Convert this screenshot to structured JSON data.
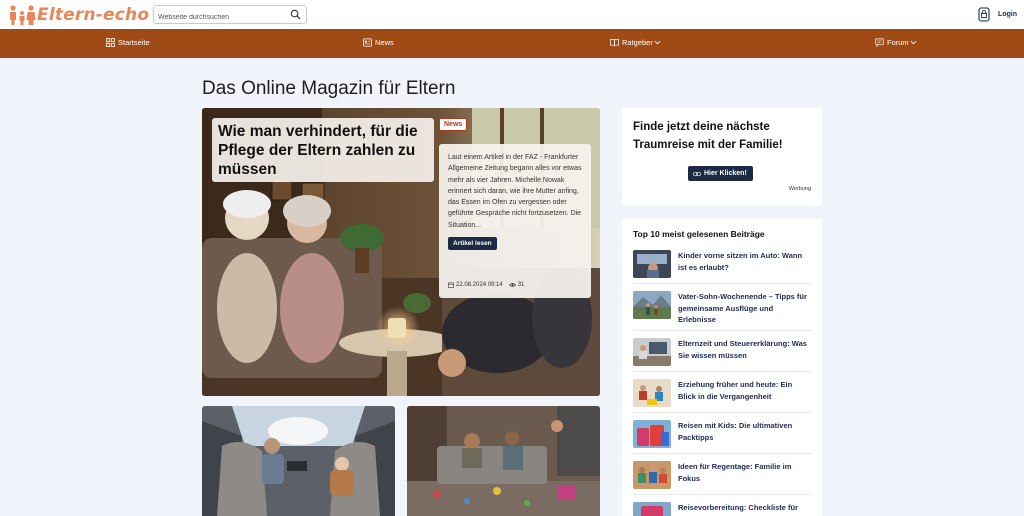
{
  "header": {
    "logo_text": "Eltern-echo",
    "search": {
      "placeholder": "Webseite durchsuchen"
    },
    "login_label": "Login"
  },
  "nav": {
    "items": [
      {
        "label": "Startseite",
        "icon": "grid-icon",
        "dropdown": false
      },
      {
        "label": "News",
        "icon": "newspaper-icon",
        "dropdown": false
      },
      {
        "label": "Ratgeber",
        "icon": "book-icon",
        "dropdown": true
      },
      {
        "label": "Forum",
        "icon": "chat-icon",
        "dropdown": true
      }
    ]
  },
  "main": {
    "page_title": "Das Online Magazin für Eltern",
    "hero": {
      "title": "Wie man verhindert, für die Pflege der Eltern zahlen zu müssen",
      "badge": "News",
      "excerpt": "Laut einem Artikel in der FAZ - Frankfurter Allgemeine Zeitung begann alles vor etwas mehr als vier Jahren. Michelle Nowak erinnert sich daran, wie ihre Mutter anfing, das Essen im Ofen zu vergessen oder geführte Gespräche nicht fortzusetzen. Die Situation...",
      "button_label": "Artikel lesen",
      "date": "22.08.2024 09:14",
      "views": "31"
    }
  },
  "sidebar": {
    "ad": {
      "title": "Finde jetzt deine nächste Traumreise mit der Familie!",
      "button_label": "Hier Klicken!",
      "label": "Werbung"
    },
    "top10": {
      "title": "Top 10 meist gelesenen Beiträge",
      "items": [
        {
          "label": "Kinder vorne sitzen im Auto: Wann ist es erlaubt?"
        },
        {
          "label": "Vater-Sohn-Wochenende – Tipps für gemeinsame Ausflüge und Erlebnisse"
        },
        {
          "label": "Elternzeit und Steuererklärung: Was Sie wissen müssen"
        },
        {
          "label": "Erziehung früher und heute: Ein Blick in die Vergangenheit"
        },
        {
          "label": "Reisen mit Kids: Die ultimativen Packtipps"
        },
        {
          "label": "Ideen für Regentage: Familie im Fokus"
        },
        {
          "label": "Reisevorbereitung: Checkliste für"
        }
      ]
    }
  },
  "colors": {
    "nav_bg": "#a04b16",
    "logo": "#e8865a",
    "button_dark": "#1d2a44",
    "link": "#1c2a55",
    "page_bg": "#f1f4fb"
  }
}
